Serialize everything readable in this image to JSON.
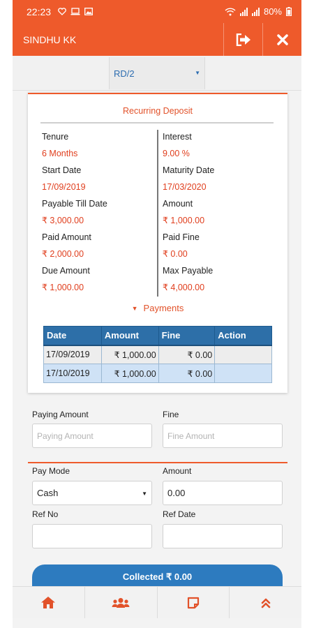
{
  "status_bar": {
    "time": "22:23",
    "battery": "80%",
    "signal_label_1": "Vo) LTE",
    "signal_label_2": "Vo) LTE"
  },
  "app_bar": {
    "user_name": "SINDHU KK",
    "logout_icon": "logout-icon",
    "close_icon": "close-icon",
    "color": "#ee5a2b"
  },
  "account_select": {
    "value": "RD/2"
  },
  "deposit": {
    "title": "Recurring Deposit",
    "left": [
      {
        "label": "Tenure",
        "value": "6 Months"
      },
      {
        "label": "Start Date",
        "value": "17/09/2019"
      },
      {
        "label": "Payable Till Date",
        "value": "₹ 3,000.00"
      },
      {
        "label": "Paid Amount",
        "value": "₹ 2,000.00"
      },
      {
        "label": "Due Amount",
        "value": "₹ 1,000.00"
      }
    ],
    "right": [
      {
        "label": "Interest",
        "value": "9.00 %"
      },
      {
        "label": "Maturity Date",
        "value": "17/03/2020"
      },
      {
        "label": "Amount",
        "value": "₹ 1,000.00"
      },
      {
        "label": "Paid Fine",
        "value": "₹ 0.00"
      },
      {
        "label": "Max Payable",
        "value": "₹ 4,000.00"
      }
    ],
    "payments_toggle": "Payments",
    "table": {
      "headers": [
        "Date",
        "Amount",
        "Fine",
        "Action"
      ],
      "rows": [
        [
          "17/09/2019",
          "₹ 1,000.00",
          "₹ 0.00",
          ""
        ],
        [
          "17/10/2019",
          "₹ 1,000.00",
          "₹ 0.00",
          ""
        ]
      ]
    }
  },
  "form": {
    "paying_amount_label": "Paying Amount",
    "paying_amount_placeholder": "Paying Amount",
    "fine_label": "Fine",
    "fine_placeholder": "Fine Amount",
    "pay_mode_label": "Pay Mode",
    "pay_mode_value": "Cash",
    "amount_label": "Amount",
    "amount_value": "0.00",
    "ref_no_label": "Ref No",
    "ref_date_label": "Ref Date"
  },
  "collect_button": "Collected ₹ 0.00",
  "bottom_nav": [
    {
      "icon": "home-icon"
    },
    {
      "icon": "group-icon"
    },
    {
      "icon": "note-icon"
    },
    {
      "icon": "double-chevron-up-icon"
    }
  ],
  "colors": {
    "accent": "#ee5a2b",
    "table_header": "#2d6fa8",
    "button": "#2d7bbf"
  }
}
